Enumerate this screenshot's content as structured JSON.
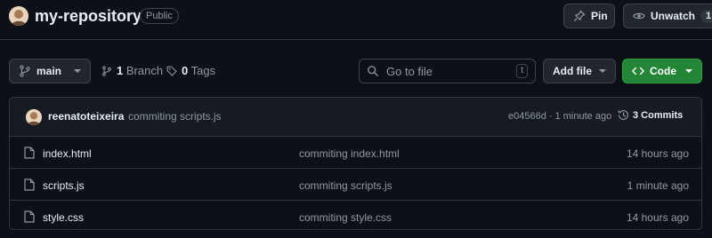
{
  "repo": {
    "name": "my-repository",
    "visibility": "Public"
  },
  "actions": {
    "pin_label": "Pin",
    "watch_label": "Unwatch",
    "watch_count": "1"
  },
  "toolbar": {
    "branch": "main",
    "branches_count": "1",
    "branches_label": "Branch",
    "tags_count": "0",
    "tags_label": "Tags",
    "search_placeholder": "Go to file",
    "search_shortcut": "t",
    "add_file_label": "Add file",
    "code_label": "Code"
  },
  "latest_commit": {
    "author": "reenatoteixeira",
    "message": "commiting scripts.js",
    "meta": "e04566d · 1 minute ago",
    "commits_label": "3 Commits"
  },
  "files": [
    {
      "name": "index.html",
      "commit": "commiting index.html",
      "time": "14 hours ago"
    },
    {
      "name": "scripts.js",
      "commit": "commiting scripts.js",
      "time": "1 minute ago"
    },
    {
      "name": "style.css",
      "commit": "commiting style.css",
      "time": "14 hours ago"
    }
  ],
  "colors": {
    "background": "#0d1117",
    "border": "#30363d",
    "code_button": "#238636",
    "muted_text": "#9198a1"
  }
}
